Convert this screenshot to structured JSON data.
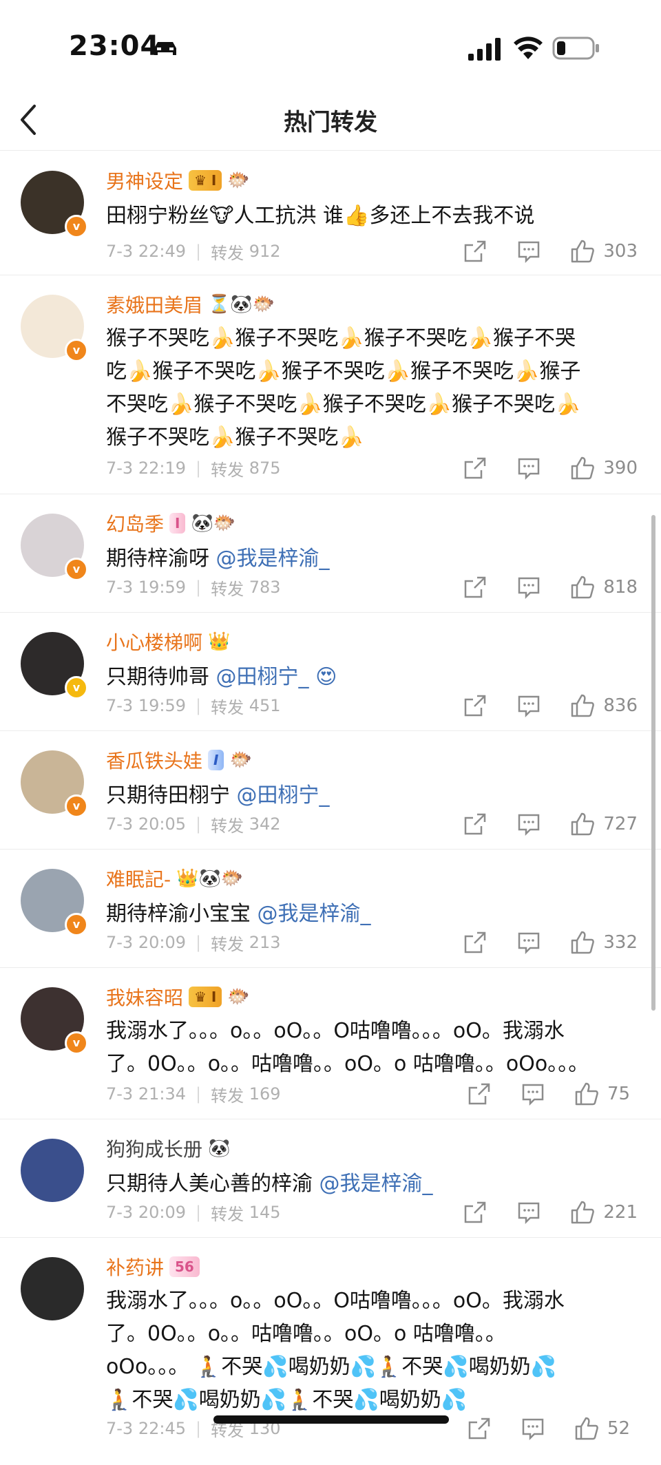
{
  "status": {
    "time": "23:04"
  },
  "nav": {
    "title": "热门转发"
  },
  "labels": {
    "repost": "转发"
  },
  "posts": [
    {
      "name": "男神设定",
      "badge": "I",
      "badge_style": "crown",
      "extra_emoji": "🐡",
      "verify": "orange",
      "avatar_color": "#3b3228",
      "content": [
        "田栩宁粉丝🐮人工抗洪 谁👍多还上不去我不说"
      ],
      "mention": "",
      "time": "7-3 22:49",
      "reposts": "912",
      "likes": "303"
    },
    {
      "name": "素娥田美眉",
      "badge": "",
      "badge_style": "",
      "extra_emoji": "⏳🐼🐡",
      "verify": "orange",
      "avatar_color": "#f3e8d8",
      "content": [
        "猴子不哭吃🍌猴子不哭吃🍌猴子不哭吃🍌猴子不哭",
        "吃🍌猴子不哭吃🍌猴子不哭吃🍌猴子不哭吃🍌猴子",
        "不哭吃🍌猴子不哭吃🍌猴子不哭吃🍌猴子不哭吃🍌",
        "猴子不哭吃🍌猴子不哭吃🍌"
      ],
      "mention": "",
      "time": "7-3 22:19",
      "reposts": "875",
      "likes": "390"
    },
    {
      "name": "幻岛季",
      "badge": "I",
      "badge_style": "pink",
      "extra_emoji": "🐼🐡",
      "verify": "orange",
      "avatar_color": "#d9d3d6",
      "content": [
        "期待梓渝呀 "
      ],
      "mention": "@我是梓渝_",
      "time": "7-3 19:59",
      "reposts": "783",
      "likes": "818"
    },
    {
      "name": "小心楼梯啊",
      "badge": "",
      "badge_style": "",
      "extra_emoji": "👑",
      "verify": "gold",
      "avatar_color": "#2d2a2a",
      "content": [
        "只期待帅哥 "
      ],
      "mention": "@田栩宁_ 😍",
      "time": "7-3 19:59",
      "reposts": "451",
      "likes": "836"
    },
    {
      "name": "香瓜铁头娃",
      "badge": "I",
      "badge_style": "member",
      "extra_emoji": "🐡",
      "verify": "orange",
      "avatar_color": "#c9b597",
      "content": [
        "只期待田栩宁 "
      ],
      "mention": "@田栩宁_",
      "time": "7-3 20:05",
      "reposts": "342",
      "likes": "727"
    },
    {
      "name": "难眠記-",
      "badge": "",
      "badge_style": "",
      "extra_emoji": "👑🐼🐡",
      "verify": "orange",
      "avatar_color": "#9aa4b0",
      "content": [
        "期待梓渝小宝宝 "
      ],
      "mention": "@我是梓渝_",
      "time": "7-3 20:09",
      "reposts": "213",
      "likes": "332"
    },
    {
      "name": "我妹容昭",
      "badge": "I",
      "badge_style": "crown",
      "extra_emoji": "🐡",
      "verify": "orange",
      "avatar_color": "#3d3130",
      "content": [
        "我溺水了。。。o。。oO。。O咕噜噜。。。oO。我溺水",
        "了。0O。。o。。咕噜噜。。oO。o 咕噜噜。。oOo。。。"
      ],
      "mention": "",
      "time": "7-3 21:34",
      "reposts": "169",
      "likes": "75"
    },
    {
      "name": "狗狗成长册",
      "badge": "",
      "badge_style": "",
      "extra_emoji": "🐼",
      "verify": "",
      "avatar_color": "#3a4f8c",
      "content": [
        "只期待人美心善的梓渝 "
      ],
      "mention": "@我是梓渝_",
      "time": "7-3 20:09",
      "reposts": "145",
      "likes": "221"
    },
    {
      "name": "补药讲",
      "badge": "56",
      "badge_style": "pink",
      "extra_emoji": "",
      "verify": "",
      "avatar_color": "#2a2a2a",
      "content": [
        "我溺水了。。。o。。oO。。O咕噜噜。。。oO。我溺水",
        "了。0O。。o。。咕噜噜。。oO。o 咕噜噜。。",
        "oOo。。。 🧎不哭💦喝奶奶💦🧎不哭💦喝奶奶💦",
        "🧎不哭💦喝奶奶💦🧎不哭💦喝奶奶💦"
      ],
      "mention": "",
      "time": "7-3 22:45",
      "reposts": "130",
      "likes": "52"
    }
  ]
}
